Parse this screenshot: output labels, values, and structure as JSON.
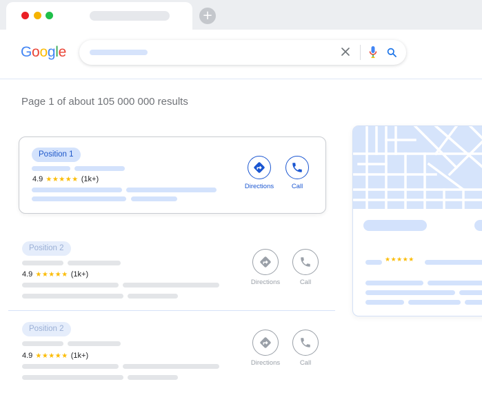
{
  "window": {
    "controls": [
      "close",
      "minimize",
      "maximize"
    ],
    "new_tab_icon": "plus-icon",
    "new_tab_glyph": "+"
  },
  "search": {
    "logo": [
      "G",
      "o",
      "o",
      "g",
      "l",
      "e"
    ],
    "icons": [
      "close-icon",
      "microphone-icon",
      "search-icon"
    ]
  },
  "results_summary": "Page 1 of about 105 000 000 results",
  "results": [
    {
      "position": "Position 1",
      "rating": "4.9",
      "stars": "★★★★★",
      "review_count": "(1k+)",
      "directions_label": "Directions",
      "call_label": "Call",
      "highlighted": true
    },
    {
      "position": "Position 2",
      "rating": "4.9",
      "stars": "★★★★★",
      "review_count": "(1k+)",
      "directions_label": "Directions",
      "call_label": "Call",
      "highlighted": false
    },
    {
      "position": "Position 2",
      "rating": "4.9",
      "stars": "★★★★★",
      "review_count": "(1k+)",
      "directions_label": "Directions",
      "call_label": "Call",
      "highlighted": false
    }
  ],
  "map_panel": {
    "stars": "★★★★★"
  },
  "colors": {
    "accent": "#1a56d1",
    "badge_bg": "#d3e2fc",
    "star": "#fbbc05",
    "muted": "#9aa0a8"
  }
}
